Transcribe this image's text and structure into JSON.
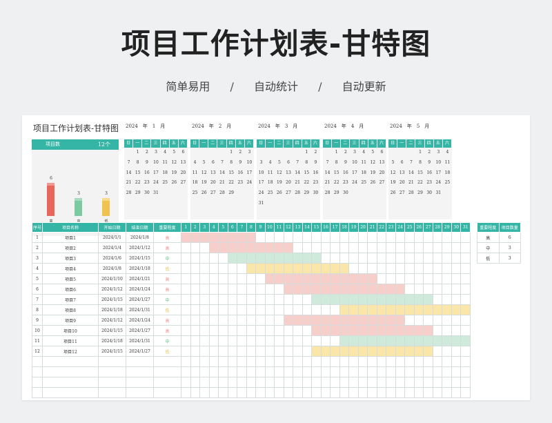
{
  "hero": {
    "title": "项目工作计划表-甘特图",
    "sub": [
      "简单易用",
      "自动统计",
      "自动更新"
    ],
    "separator": "/"
  },
  "sheet": {
    "title": "项目工作计划表-甘特图"
  },
  "summary": {
    "label": "项目数",
    "count": "12个",
    "bars": [
      {
        "label": "高",
        "value": 6,
        "color": "#e8675c",
        "top": "#f19990"
      },
      {
        "label": "中",
        "value": 3,
        "color": "#7bcba0",
        "top": "#a6dcbd"
      },
      {
        "label": "低",
        "value": 3,
        "color": "#f0c34f",
        "top": "#f7da8c"
      }
    ]
  },
  "calendars": [
    {
      "year": "2024",
      "year_unit": "年",
      "month": "1",
      "month_unit": "月",
      "offset": 1,
      "days": 31
    },
    {
      "year": "2024",
      "year_unit": "年",
      "month": "2",
      "month_unit": "月",
      "offset": 4,
      "days": 29
    },
    {
      "year": "2024",
      "year_unit": "年",
      "month": "3",
      "month_unit": "月",
      "offset": 5,
      "days": 31
    },
    {
      "year": "2024",
      "year_unit": "年",
      "month": "4",
      "month_unit": "月",
      "offset": 1,
      "days": 30
    },
    {
      "year": "2024",
      "year_unit": "年",
      "month": "5",
      "month_unit": "月",
      "offset": 3,
      "days": 31
    }
  ],
  "weekdays": [
    "日",
    "一",
    "二",
    "三",
    "四",
    "五",
    "六"
  ],
  "table": {
    "headers": {
      "seq": "序号",
      "name": "项目名称",
      "start": "开始日期",
      "end": "结束日期",
      "priority": "重要程度"
    },
    "day_headers": [
      "1",
      "2",
      "3",
      "4",
      "5",
      "6",
      "7",
      "8",
      "9",
      "10",
      "11",
      "12",
      "13",
      "14",
      "15",
      "16",
      "17",
      "18",
      "19",
      "20",
      "21",
      "22",
      "23",
      "24",
      "25",
      "26",
      "27",
      "28",
      "29",
      "30",
      "31"
    ],
    "rows": [
      {
        "seq": "1",
        "name": "项目1",
        "start": "2024/1/1",
        "end": "2024/1/8",
        "priority": "高",
        "level": "high",
        "s": 1,
        "e": 8
      },
      {
        "seq": "2",
        "name": "项目2",
        "start": "2024/1/4",
        "end": "2024/1/12",
        "priority": "高",
        "level": "high",
        "s": 4,
        "e": 12
      },
      {
        "seq": "3",
        "name": "项目3",
        "start": "2024/1/6",
        "end": "2024/1/15",
        "priority": "中",
        "level": "mid",
        "s": 6,
        "e": 15
      },
      {
        "seq": "4",
        "name": "项目4",
        "start": "2024/1/8",
        "end": "2024/1/18",
        "priority": "低",
        "level": "low",
        "s": 8,
        "e": 18
      },
      {
        "seq": "5",
        "name": "项目5",
        "start": "2024/1/10",
        "end": "2024/1/21",
        "priority": "高",
        "level": "high",
        "s": 10,
        "e": 21
      },
      {
        "seq": "6",
        "name": "项目6",
        "start": "2024/1/12",
        "end": "2024/1/24",
        "priority": "高",
        "level": "high",
        "s": 12,
        "e": 24
      },
      {
        "seq": "7",
        "name": "项目7",
        "start": "2024/1/15",
        "end": "2024/1/27",
        "priority": "中",
        "level": "mid",
        "s": 15,
        "e": 27
      },
      {
        "seq": "8",
        "name": "项目8",
        "start": "2024/1/18",
        "end": "2024/1/31",
        "priority": "低",
        "level": "low",
        "s": 18,
        "e": 31
      },
      {
        "seq": "9",
        "name": "项目9",
        "start": "2024/1/12",
        "end": "2024/1/24",
        "priority": "高",
        "level": "high",
        "s": 12,
        "e": 24
      },
      {
        "seq": "10",
        "name": "项目10",
        "start": "2024/1/15",
        "end": "2024/1/27",
        "priority": "高",
        "level": "high",
        "s": 15,
        "e": 27
      },
      {
        "seq": "11",
        "name": "项目11",
        "start": "2024/1/18",
        "end": "2024/1/31",
        "priority": "中",
        "level": "mid",
        "s": 18,
        "e": 31
      },
      {
        "seq": "12",
        "name": "项目12",
        "start": "2024/1/15",
        "end": "2024/1/27",
        "priority": "低",
        "level": "low",
        "s": 15,
        "e": 27
      }
    ],
    "empty_rows": 4
  },
  "stats": {
    "headers": [
      "重要程度",
      "项目数量"
    ],
    "rows": [
      [
        "高",
        "6"
      ],
      [
        "中",
        "3"
      ],
      [
        "低",
        "3"
      ]
    ]
  }
}
